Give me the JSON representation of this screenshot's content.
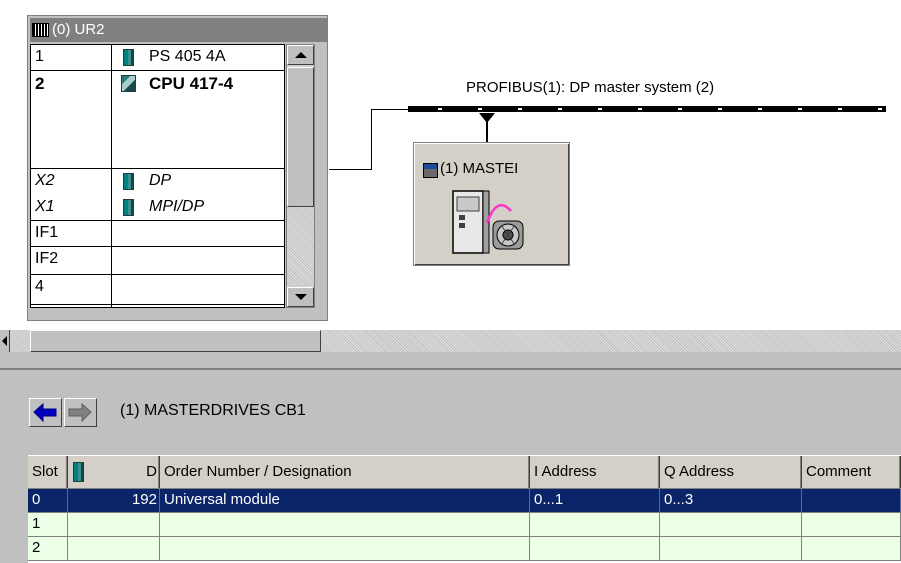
{
  "rack": {
    "title": "(0) UR2",
    "rows": [
      {
        "slot": "1",
        "module": "PS 405 4A",
        "style": "normal",
        "icon": "module-icon"
      },
      {
        "slot": "2",
        "module": "CPU 417-4",
        "style": "bold",
        "icon": "cpu-icon"
      },
      {
        "slot": "X2",
        "module": "DP",
        "style": "italic",
        "icon": "module-icon"
      },
      {
        "slot": "X1",
        "module": "MPI/DP",
        "style": "italic",
        "icon": "module-icon"
      },
      {
        "slot": "IF1",
        "module": "",
        "style": "normal",
        "icon": ""
      },
      {
        "slot": "IF2",
        "module": "",
        "style": "normal",
        "icon": ""
      },
      {
        "slot": "4",
        "module": "",
        "style": "normal",
        "icon": ""
      }
    ]
  },
  "network": {
    "bus_label": "PROFIBUS(1): DP master system (2)"
  },
  "drive": {
    "title": "(1) MASTEI",
    "icon": "masterdrive-icon"
  },
  "detail": {
    "back_icon": "arrow-left-icon",
    "forward_icon": "arrow-right-icon",
    "title": "(1)   MASTERDRIVES CB1",
    "columns": [
      "Slot",
      "D",
      "Order Number / Designation",
      "I Address",
      "Q Address",
      "Comment"
    ],
    "rows": [
      {
        "slot": "0",
        "d": "192",
        "designation": "Universal module",
        "i_address": "0...1",
        "q_address": "0...3",
        "comment": ""
      },
      {
        "slot": "1",
        "d": "",
        "designation": "",
        "i_address": "",
        "q_address": "",
        "comment": ""
      },
      {
        "slot": "2",
        "d": "",
        "designation": "",
        "i_address": "",
        "q_address": "",
        "comment": ""
      }
    ]
  },
  "colors": {
    "selection": "#0a246a",
    "row_bg": "#ecffe6",
    "chrome": "#c0c0c0"
  }
}
